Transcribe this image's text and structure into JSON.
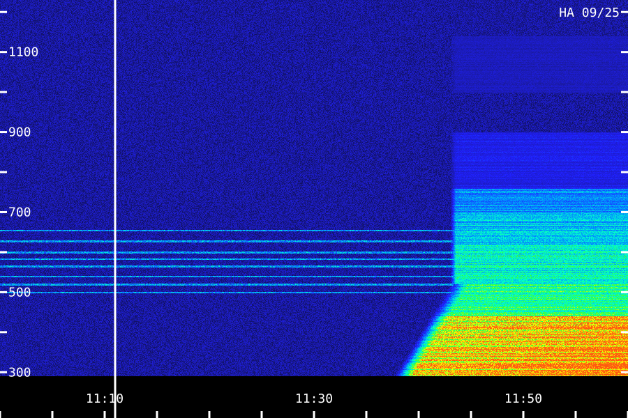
{
  "chart_data": {
    "type": "heatmap",
    "title": "HA 09/25",
    "xlabel": "",
    "ylabel": "",
    "x_ticks": [
      "11:10",
      "11:30",
      "11:50"
    ],
    "y_ticks": [
      300,
      500,
      700,
      900,
      1100
    ],
    "ylim": [
      290,
      1230
    ],
    "xlim": [
      "11:00",
      "12:00"
    ],
    "colormap": [
      "#0a0a40",
      "#1a1aa0",
      "#2020ff",
      "#0090ff",
      "#00ffd0",
      "#30ff40",
      "#ffff00",
      "#ff5a10"
    ],
    "marker_time": "11:11",
    "onset_time": "11:43",
    "bands": [
      {
        "range": [
          290,
          360
        ],
        "level": 0.92
      },
      {
        "range": [
          360,
          440
        ],
        "level": 0.88
      },
      {
        "range": [
          440,
          520
        ],
        "level": 0.66
      },
      {
        "range": [
          520,
          620
        ],
        "level": 0.6
      },
      {
        "range": [
          620,
          700
        ],
        "level": 0.5
      },
      {
        "range": [
          700,
          760
        ],
        "level": 0.44
      },
      {
        "range": [
          760,
          900
        ],
        "level": 0.26
      },
      {
        "range": [
          900,
          1000
        ],
        "level": 0.06
      },
      {
        "range": [
          1000,
          1140
        ],
        "level": 0.18
      },
      {
        "range": [
          1140,
          1230
        ],
        "level": 0.08
      }
    ],
    "interference_lines_mhz": [
      655,
      628,
      600,
      583,
      565,
      540,
      520,
      500
    ]
  },
  "colors": {
    "background": "#000000",
    "axis": "#ffffff"
  }
}
